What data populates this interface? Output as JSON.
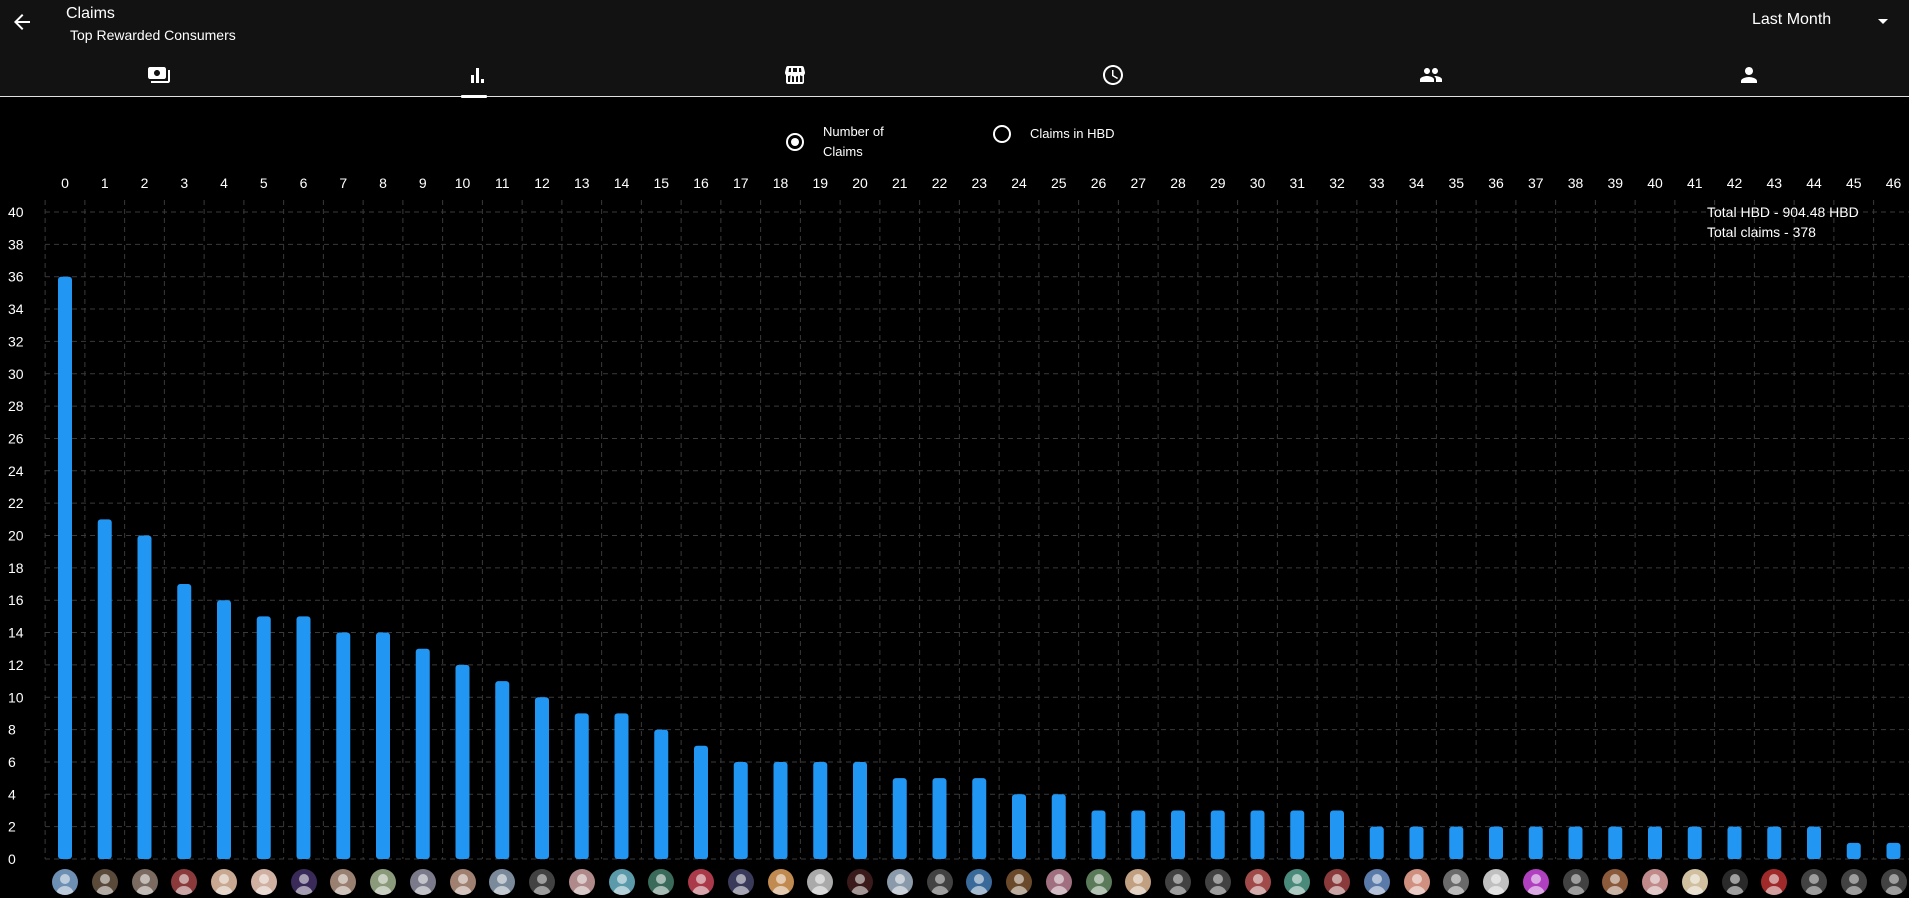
{
  "header": {
    "title": "Claims",
    "subtitle": "Top Rewarded Consumers",
    "period": "Last Month",
    "back_icon": "arrow-back-icon"
  },
  "tabs": [
    {
      "icon": "payments-icon",
      "active": false
    },
    {
      "icon": "leaderboard-icon",
      "active": true
    },
    {
      "icon": "store-icon",
      "active": false
    },
    {
      "icon": "clock-icon",
      "active": false
    },
    {
      "icon": "group-icon",
      "active": false
    },
    {
      "icon": "person-icon",
      "active": false
    }
  ],
  "radio": {
    "option1": "Number of\nClaims",
    "option2": "Claims in HBD",
    "selected": "option1"
  },
  "totals": {
    "hbd": "Total HBD - 904.48 HBD",
    "claims": "Total claims - 378"
  },
  "colors": {
    "bar": "#2196f3",
    "background": "#000000",
    "appbar": "#121212",
    "grid": "#3a3a3a"
  },
  "chart_data": {
    "type": "bar",
    "categories": [
      "0",
      "1",
      "2",
      "3",
      "4",
      "5",
      "6",
      "7",
      "8",
      "9",
      "10",
      "11",
      "12",
      "13",
      "14",
      "15",
      "16",
      "17",
      "18",
      "19",
      "20",
      "21",
      "22",
      "23",
      "24",
      "25",
      "26",
      "27",
      "28",
      "29",
      "30",
      "31",
      "32",
      "33",
      "34",
      "35",
      "36",
      "37",
      "38",
      "39",
      "40",
      "41",
      "42",
      "43",
      "44",
      "45",
      "46"
    ],
    "values": [
      36,
      21,
      20,
      17,
      16,
      15,
      15,
      14,
      14,
      13,
      12,
      11,
      10,
      9,
      9,
      8,
      7,
      6,
      6,
      6,
      6,
      5,
      5,
      5,
      4,
      4,
      3,
      3,
      3,
      3,
      3,
      3,
      3,
      2,
      2,
      2,
      2,
      2,
      2,
      2,
      2,
      2,
      2,
      2,
      2,
      1,
      1
    ],
    "ylim": [
      0,
      40
    ],
    "yticks": [
      0,
      2,
      4,
      6,
      8,
      10,
      12,
      14,
      16,
      18,
      20,
      22,
      24,
      26,
      28,
      30,
      32,
      34,
      36,
      38,
      40
    ],
    "x_axis_position": "top",
    "grid": true,
    "grid_style": "dashed"
  },
  "avatars": [
    "#6d8fb3",
    "#5a4a3a",
    "#7a6a60",
    "#8a3a3a",
    "#c8a890",
    "#d0b0a0",
    "#3a2a5a",
    "#9a8070",
    "#8a9a7a",
    "#7a7a8a",
    "#a08070",
    "#7a8a9a",
    "default",
    "#b08a8a",
    "#5a9aaa",
    "#3a6a5a",
    "#aa3a4a",
    "#3a3a5a",
    "#c08a50",
    "#aaaaaa",
    "#3a1a1a",
    "#8a9aaa",
    "default",
    "#3a6a9a",
    "#6a4a2a",
    "#a07080",
    "#5a7a5a",
    "#c0a080",
    "default",
    "default",
    "#a04a4a",
    "#4a8a7a",
    "#8a3a3a",
    "#5a7aaa",
    "#d09080",
    "#6a6a6a",
    "#c0c0c0",
    "#b040c0",
    "default",
    "#8a5a3a",
    "#c08a8a",
    "#d0c0a0",
    "#2a2a2a",
    "#a02a2a",
    "default",
    "default",
    "default"
  ]
}
